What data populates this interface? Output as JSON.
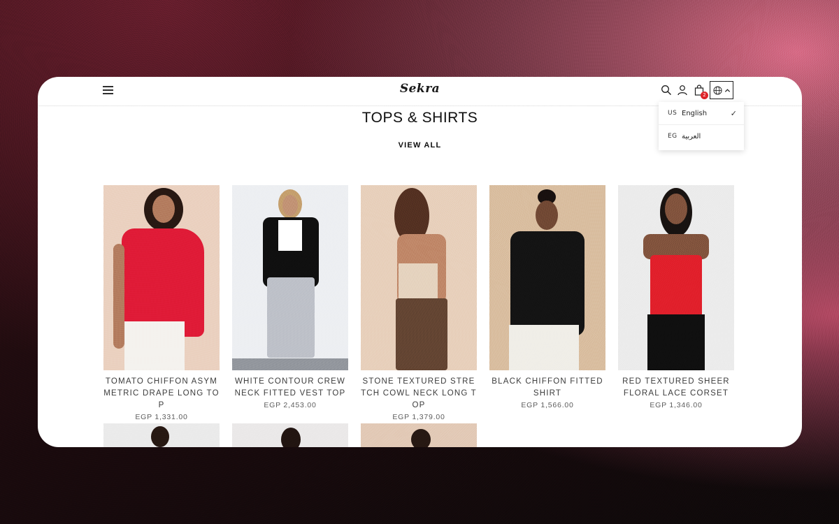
{
  "header": {
    "logo": "Sekra",
    "cart_count": "2"
  },
  "language_menu": {
    "items": [
      {
        "code": "US",
        "label": "English",
        "selected": true
      },
      {
        "code": "EG",
        "label": "العربية",
        "selected": false
      }
    ],
    "check_mark": "✓"
  },
  "section": {
    "title": "TOPS & SHIRTS",
    "view_all": "VIEW ALL"
  },
  "products": [
    {
      "name": "TOMATO CHIFFON ASYMMETRIC DRAPE LONG TOP",
      "price": "EGP 1,331.00"
    },
    {
      "name": "WHITE CONTOUR CREW NECK FITTED VEST TOP",
      "price": "EGP 2,453.00"
    },
    {
      "name": "STONE TEXTURED STRETCH COWL NECK LONG TOP",
      "price": "EGP 1,379.00"
    },
    {
      "name": "BLACK CHIFFON FITTED SHIRT",
      "price": "EGP 1,566.00"
    },
    {
      "name": "RED TEXTURED SHEER FLORAL LACE CORSET",
      "price": "EGP 1,346.00"
    }
  ],
  "colors": {
    "badge": "#e0262c",
    "text": "#111111"
  },
  "icons": [
    "menu-icon",
    "search-icon",
    "user-icon",
    "bag-icon",
    "globe-icon",
    "chevron-up-icon",
    "check-icon"
  ]
}
